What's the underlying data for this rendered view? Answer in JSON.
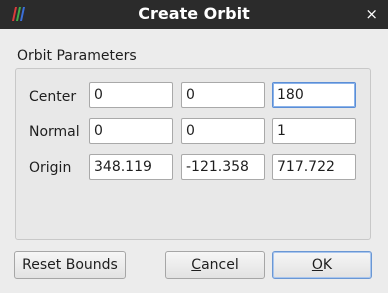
{
  "window": {
    "title": "Create Orbit",
    "close_glyph": "×",
    "logo_icon": "paraview-logo-icon"
  },
  "group": {
    "title": "Orbit Parameters",
    "rows": [
      {
        "label": "Center",
        "values": [
          "0",
          "0",
          "180"
        ]
      },
      {
        "label": "Normal",
        "values": [
          "0",
          "0",
          "1"
        ]
      },
      {
        "label": "Origin",
        "values": [
          "348.119",
          "-121.358",
          "717.722"
        ]
      }
    ]
  },
  "buttons": {
    "reset_bounds": "Reset Bounds",
    "cancel_mnemonic": "C",
    "cancel_rest": "ancel",
    "ok_mnemonic": "O",
    "ok_rest": "K"
  },
  "colors": {
    "titlebar": "#2b2b2b",
    "focus": "#5b8ed6"
  }
}
